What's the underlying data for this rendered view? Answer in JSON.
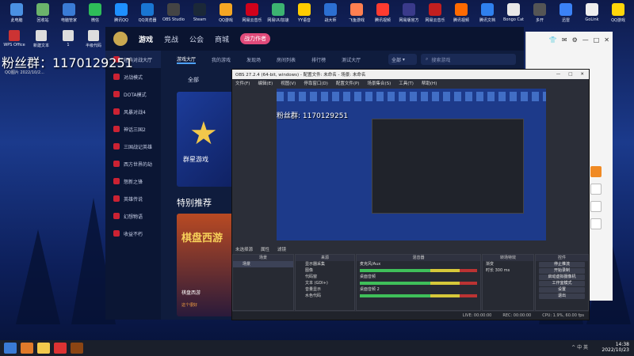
{
  "desktop": {
    "top_icons": [
      "此电脑",
      "回收站",
      "电脑管家",
      "微信",
      "腾讯QQ",
      "QQ浏览器",
      "OBS Studio",
      "Steam",
      "QQ游戏",
      "网易云音乐",
      "网易UU加速",
      "YY语音",
      "战大师",
      "飞鱼游戏",
      "腾讯视频",
      "网易版官方",
      "网易云音乐",
      "腾讯视频",
      "腾讯文档",
      "Bongo Cat",
      "多开",
      "迅雷",
      "GoLink",
      "QQ游戏"
    ],
    "left_icons": [
      "WPS Office",
      "新建文本",
      "1",
      "半级代码"
    ],
    "overlay_text": "粉丝群：1170129251",
    "overlay_sub": "QQ图片 2022/10/2..."
  },
  "client": {
    "nav": [
      "游戏",
      "竞战",
      "公会",
      "商城"
    ],
    "badge": "战力作者",
    "tabs": [
      "游戏大厅",
      "我的游戏",
      "发现场",
      "房间列表",
      "排行榜",
      "测试大厅"
    ],
    "all_label": "全部",
    "dropdown": "全部",
    "search_placeholder": "搜索游戏",
    "sidebar": [
      "经典对战大厅",
      "对战模式",
      "DOTA模式",
      "风暴对战4",
      "神话三国2",
      "三国战记英雄",
      "西方世界的劫",
      "怒新之锋",
      "英雄传说",
      "幻想物语",
      "收益不朽"
    ],
    "feature_title": "特别推荐",
    "banner1_text": "群星游戏",
    "banner2_title": "棋盘西游",
    "banner2_name": "棋盘西游",
    "banner2_rating": "这个很好"
  },
  "obs": {
    "title": "OBS 27.2.4 (64-bit, windows) - 配置文件: 未命名 - 场景: 未命名",
    "menu": [
      "文件(F)",
      "编辑(E)",
      "视图(V)",
      "停靠窗口(D)",
      "配置文件(P)",
      "场景集合(S)",
      "工具(T)",
      "帮助(H)"
    ],
    "preview_text": "粉丝群: 1170129251",
    "ctrlbar": [
      "未选择源",
      "属性",
      "滤镜"
    ],
    "docks": {
      "scenes": {
        "header": "场景",
        "items": [
          "场景"
        ]
      },
      "sources": {
        "header": "来源",
        "items": [
          "显示器采集",
          "图像",
          "代码窗",
          "文本 (GDI+)",
          "音量显示",
          "水色代码"
        ]
      },
      "mixer": {
        "header": "混音器",
        "channels": [
          "麦克风/Aux",
          "桌面音频",
          "桌面音频 2"
        ]
      },
      "transitions": {
        "header": "转场特效",
        "mode": "渐变",
        "duration_label": "时长",
        "duration": "300 ms"
      },
      "controls": {
        "header": "控件",
        "buttons": [
          "停止推流",
          "开始录制",
          "启动虚拟摄像机",
          "工作室模式",
          "设置",
          "退出"
        ]
      }
    },
    "status": [
      "LIVE: 00:00:00",
      "REC: 00:00:00",
      "CPU: 1.9%, 60.00 fps"
    ]
  },
  "browser": {
    "toolbar_icons": [
      "shirt-icon",
      "message-icon",
      "settings-icon",
      "minimize-icon",
      "maximize-icon",
      "close-icon"
    ]
  },
  "taskbar": {
    "time": "14:38",
    "date": "2022/10/23",
    "tray": "^ 中 英"
  }
}
